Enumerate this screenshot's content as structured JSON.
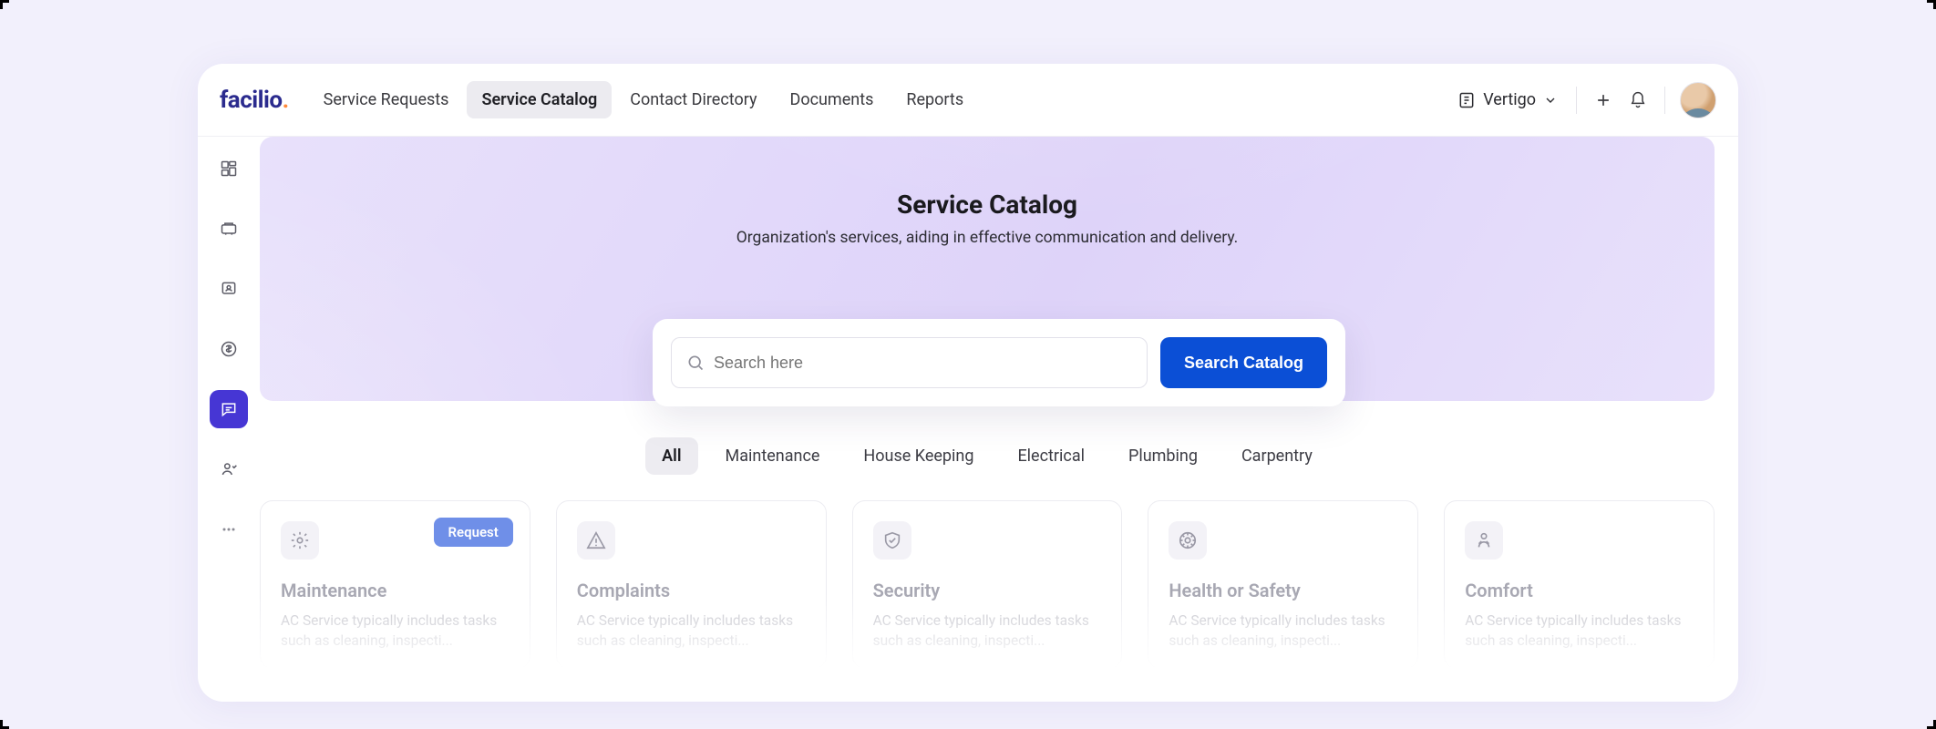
{
  "brand": {
    "name": "facilio"
  },
  "topnav": {
    "items": [
      {
        "label": "Service Requests"
      },
      {
        "label": "Service Catalog"
      },
      {
        "label": "Contact Directory"
      },
      {
        "label": "Documents"
      },
      {
        "label": "Reports"
      }
    ],
    "active_index": 1
  },
  "workspace": {
    "name": "Vertigo"
  },
  "hero": {
    "title": "Service Catalog",
    "subtitle": "Organization's services, aiding in effective communication and delivery."
  },
  "search": {
    "placeholder": "Search here",
    "value": "",
    "button_label": "Search Catalog"
  },
  "filters": {
    "items": [
      {
        "label": "All"
      },
      {
        "label": "Maintenance"
      },
      {
        "label": "House Keeping"
      },
      {
        "label": "Electrical"
      },
      {
        "label": "Plumbing"
      },
      {
        "label": "Carpentry"
      }
    ],
    "active_index": 0
  },
  "cards": [
    {
      "title": "Maintenance",
      "desc": "AC Service typically includes tasks such as cleaning, inspecti...",
      "request_label": "Request",
      "icon": "gear"
    },
    {
      "title": "Complaints",
      "desc": "AC Service typically includes tasks such as cleaning, inspecti...",
      "icon": "alert"
    },
    {
      "title": "Security",
      "desc": "AC Service typically includes tasks such as cleaning, inspecti...",
      "icon": "shield"
    },
    {
      "title": "Health or Safety",
      "desc": "AC Service typically includes tasks such as cleaning, inspecti...",
      "icon": "safety"
    },
    {
      "title": "Comfort",
      "desc": "AC Service typically includes tasks such as cleaning, inspecti...",
      "icon": "comfort"
    }
  ]
}
